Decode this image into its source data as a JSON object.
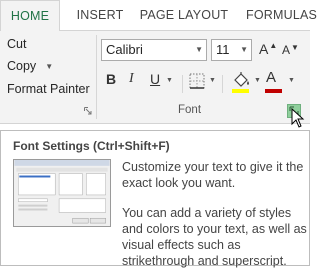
{
  "tabs": [
    {
      "label": "HOME",
      "active": true
    },
    {
      "label": "INSERT",
      "active": false
    },
    {
      "label": "PAGE LAYOUT",
      "active": false
    },
    {
      "label": "FORMULAS",
      "active": false
    }
  ],
  "clipboard": {
    "cut_label": "Cut",
    "copy_label": "Copy",
    "format_painter_label": "Format Painter"
  },
  "font_group": {
    "font_name": "Calibri",
    "font_size": "11",
    "grow_letter": "A",
    "shrink_letter": "A",
    "bold_label": "B",
    "italic_label": "I",
    "underline_label": "U",
    "font_color_letter": "A",
    "group_label": "Font",
    "fill_color": "#ffff00",
    "font_color": "#c00000"
  },
  "tooltip": {
    "title": "Font Settings (Ctrl+Shift+F)",
    "paragraph1": "Customize your text to give it the exact look you want.",
    "paragraph2": "You can add a variety of styles and colors to your text, as well as visual effects such as strikethrough and superscript."
  },
  "colors": {
    "accent": "#217346",
    "ribbon_bg": "#f3f3f3"
  }
}
